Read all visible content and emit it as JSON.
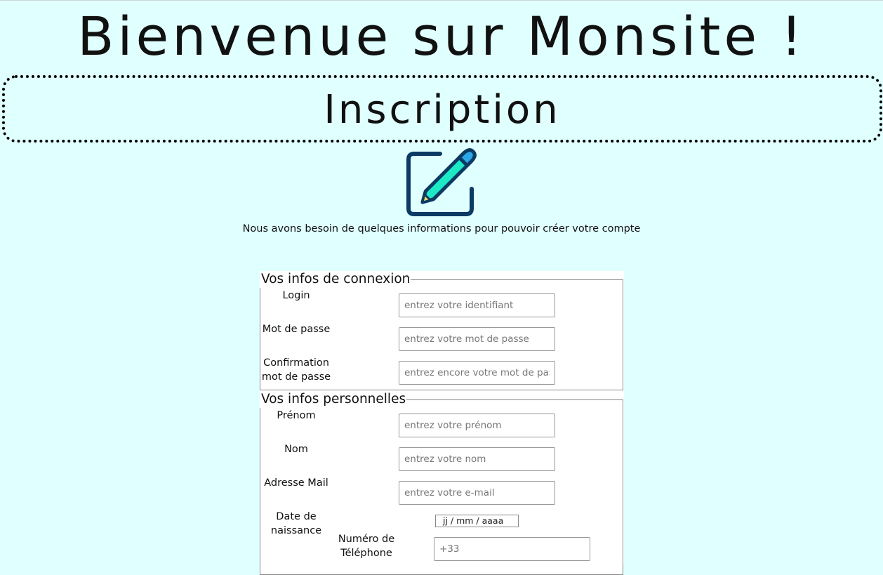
{
  "page": {
    "site_title": "Bienvenue sur Monsite !",
    "section_title": "Inscription",
    "icon": "edit-document-icon",
    "intro": "Nous avons besoin de quelques informations pour pouvoir créer votre compte"
  },
  "colors": {
    "background": "#e0ffff",
    "icon_outline": "#0b3a63",
    "icon_pencil": "#1de9c6",
    "icon_eraser": "#2aa8e8",
    "icon_tip": "#f4d35e"
  },
  "connexion": {
    "legend": "Vos infos de connexion",
    "login_label": "Login",
    "login_placeholder": "entrez votre identifiant",
    "password_label": "Mot de passe",
    "password_placeholder": "entrez votre mot de passe",
    "confirm_label_line1": "Confirmation",
    "confirm_label_line2": "mot de passe",
    "confirm_placeholder": "entrez encore votre mot de passe"
  },
  "personnel": {
    "legend": "Vos infos personnelles",
    "firstname_label": "Prénom",
    "firstname_placeholder": "entrez votre prénom",
    "lastname_label": "Nom",
    "lastname_placeholder": "entrez votre nom",
    "email_label": "Adresse Mail",
    "email_placeholder": "entrez votre e-mail",
    "birthdate_label_line1": "Date de",
    "birthdate_label_line2": "naissance",
    "birthdate_placeholder": "jj / mm / aaaa",
    "phone_label_line1": "Numéro de",
    "phone_label_line2": "Téléphone",
    "phone_placeholder": "+33"
  }
}
